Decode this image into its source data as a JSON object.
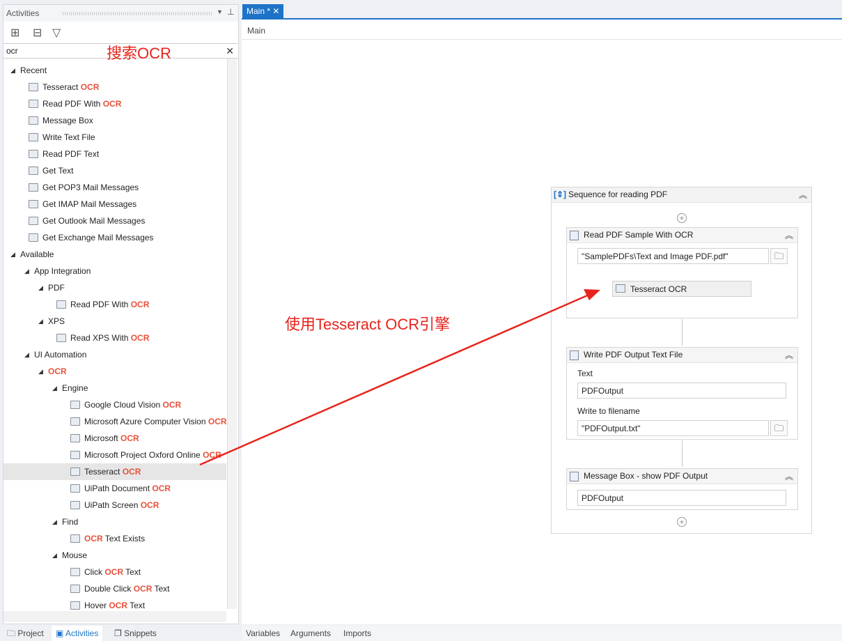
{
  "activities_panel": {
    "title": "Activities",
    "search_value": "ocr",
    "annotation": "搜索OCR"
  },
  "tree": [
    {
      "level": 0,
      "type": "group",
      "pre": "Recent"
    },
    {
      "level": 1,
      "type": "item",
      "pre": "Tesseract ",
      "hl": "OCR"
    },
    {
      "level": 1,
      "type": "item",
      "pre": "Read PDF With ",
      "hl": "OCR"
    },
    {
      "level": 1,
      "type": "item",
      "pre": "Message Box"
    },
    {
      "level": 1,
      "type": "item",
      "pre": "Write Text File"
    },
    {
      "level": 1,
      "type": "item",
      "pre": "Read PDF Text"
    },
    {
      "level": 1,
      "type": "item",
      "pre": "Get Text"
    },
    {
      "level": 1,
      "type": "item",
      "pre": "Get POP3 Mail Messages"
    },
    {
      "level": 1,
      "type": "item",
      "pre": "Get IMAP Mail Messages"
    },
    {
      "level": 1,
      "type": "item",
      "pre": "Get Outlook Mail Messages"
    },
    {
      "level": 1,
      "type": "item",
      "pre": "Get Exchange Mail Messages"
    },
    {
      "level": 0,
      "type": "group",
      "pre": "Available"
    },
    {
      "level": 1,
      "type": "group",
      "pre": "App Integration"
    },
    {
      "level": 2,
      "type": "group",
      "pre": "PDF"
    },
    {
      "level": 3,
      "type": "item",
      "pre": "Read PDF With ",
      "hl": "OCR"
    },
    {
      "level": 2,
      "type": "group",
      "pre": "XPS"
    },
    {
      "level": 3,
      "type": "item",
      "pre": "Read XPS With ",
      "hl": "OCR"
    },
    {
      "level": 1,
      "type": "group",
      "pre": "UI Automation"
    },
    {
      "level": 2,
      "type": "group",
      "pre": "",
      "hl": "OCR"
    },
    {
      "level": 3,
      "type": "group",
      "pre": "Engine"
    },
    {
      "level": 4,
      "type": "item",
      "pre": "Google Cloud Vision ",
      "hl": "OCR"
    },
    {
      "level": 4,
      "type": "item",
      "pre": "Microsoft Azure Computer Vision ",
      "hl": "OCR"
    },
    {
      "level": 4,
      "type": "item",
      "pre": "Microsoft ",
      "hl": "OCR"
    },
    {
      "level": 4,
      "type": "item",
      "pre": "Microsoft Project Oxford Online ",
      "hl": "OCR"
    },
    {
      "level": 4,
      "type": "item",
      "pre": "Tesseract ",
      "hl": "OCR",
      "selected": true
    },
    {
      "level": 4,
      "type": "item",
      "pre": "UiPath Document ",
      "hl": "OCR"
    },
    {
      "level": 4,
      "type": "item",
      "pre": "UiPath Screen ",
      "hl": "OCR"
    },
    {
      "level": 3,
      "type": "group",
      "pre": "Find"
    },
    {
      "level": 4,
      "type": "item",
      "pre": "",
      "hl": "OCR",
      "post": " Text Exists"
    },
    {
      "level": 3,
      "type": "group",
      "pre": "Mouse"
    },
    {
      "level": 4,
      "type": "item",
      "pre": "Click ",
      "hl": "OCR",
      "post": " Text"
    },
    {
      "level": 4,
      "type": "item",
      "pre": "Double Click ",
      "hl": "OCR",
      "post": " Text"
    },
    {
      "level": 4,
      "type": "item",
      "pre": "Hover ",
      "hl": "OCR",
      "post": " Text"
    }
  ],
  "bottom_tabs": [
    "Project",
    "Activities",
    "Snippets"
  ],
  "editor": {
    "tab": "Main *",
    "breadcrumb": "Main",
    "annotation": "使用Tesseract OCR引擎",
    "sequence": {
      "title": "Sequence for reading PDF",
      "read_pdf": {
        "title": "Read PDF Sample With OCR",
        "file": "\"SamplePDFs\\Text and Image PDF.pdf\"",
        "engine": "Tesseract OCR"
      },
      "write_file": {
        "title": "Write PDF Output Text File",
        "text_label": "Text",
        "text_value": "PDFOutput",
        "filename_label": "Write to filename",
        "filename_value": "\"PDFOutput.txt\""
      },
      "message_box": {
        "title": "Message Box - show PDF Output",
        "value": "PDFOutput"
      }
    },
    "bottom_tabs": [
      "Variables",
      "Arguments",
      "Imports"
    ]
  },
  "colors": {
    "accent": "#1e73c8",
    "highlight": "#e8513a",
    "annotation": "#e8231c"
  }
}
